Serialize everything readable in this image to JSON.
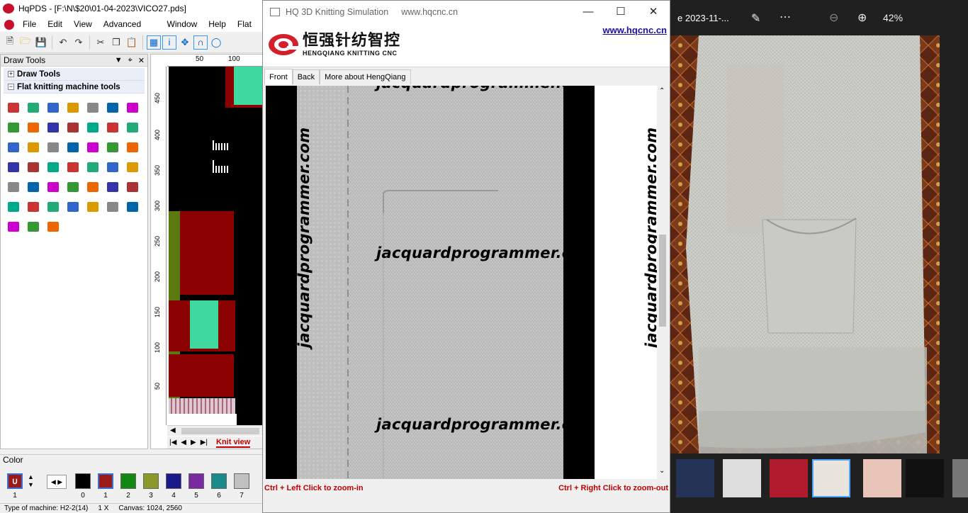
{
  "main_app": {
    "title": "HqPDS - [F:\\N\\$20\\01-04-2023\\VICO27.pds]",
    "menu": [
      "File",
      "Edit",
      "View",
      "Advanced Tools",
      "Window",
      "Help",
      "Flat m"
    ],
    "draw_tools_title": "Draw Tools",
    "groups": {
      "draw_tools": "Draw Tools",
      "flat_knitting": "Flat knitting machine tools"
    },
    "ruler_top": [
      "50",
      "100"
    ],
    "ruler_left": [
      "450",
      "400",
      "350",
      "300",
      "250",
      "200",
      "150",
      "100",
      "50"
    ],
    "knit_view_tab": "Knit view",
    "color_label": "Color",
    "color_swatches": [
      {
        "num": "0",
        "color": "#000000"
      },
      {
        "num": "1",
        "color": "#9b1b1b"
      },
      {
        "num": "2",
        "color": "#118811"
      },
      {
        "num": "3",
        "color": "#8a9a2a"
      },
      {
        "num": "4",
        "color": "#1a1a8a"
      },
      {
        "num": "5",
        "color": "#7a2aa0"
      },
      {
        "num": "6",
        "color": "#1a8a8a"
      },
      {
        "num": "7",
        "color": "#c0c0c0"
      }
    ],
    "current_color_num": "1",
    "status": {
      "machine": "Type of machine: H2-2(14)",
      "zoom": "1 X",
      "canvas": "Canvas: 1024, 2560"
    }
  },
  "simulation": {
    "title": "HQ 3D Knitting Simulation",
    "site_in_title": "www.hqcnc.cn",
    "link": "www.hqcnc.cn",
    "logo_cn": "恒强针纺智控",
    "logo_en": "HENGQIANG KNITTING CNC",
    "tabs": [
      "Front",
      "Back",
      "More about HengQiang"
    ],
    "watermark": "jacquardprogrammer.com",
    "watermark_cut": "jacquardprogrammer.co",
    "hint_left": "Ctrl + Left Click to zoom-in",
    "hint_right": "Ctrl + Right Click to zoom-out"
  },
  "photos": {
    "title": "e 2023-11-...",
    "zoom": "42%",
    "icons": [
      "edit-icon",
      "more-icon",
      "zoom-out-icon",
      "zoom-in-icon"
    ]
  }
}
